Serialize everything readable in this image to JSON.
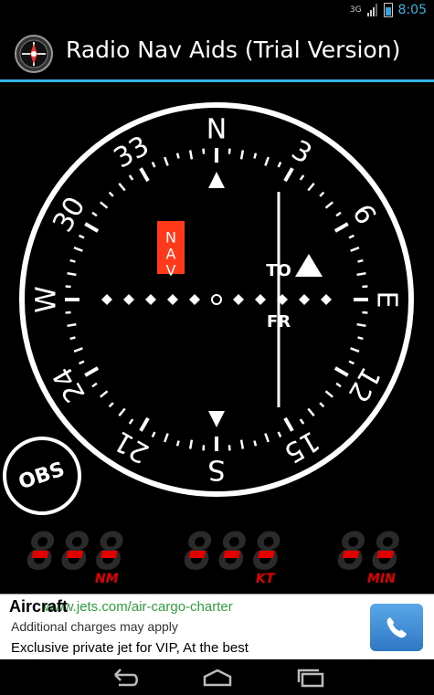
{
  "status_bar": {
    "network": "3G",
    "time": "8:05"
  },
  "action_bar": {
    "app_icon": "compass-instrument-icon",
    "title": "Radio Nav Aids (Trial Version)"
  },
  "instrument": {
    "cardinals": {
      "north": "N",
      "east": "E",
      "south": "S",
      "west": "W"
    },
    "bearing_labels": [
      "3",
      "6",
      "12",
      "15",
      "21",
      "24",
      "30",
      "33"
    ],
    "nav_flag": "NAV",
    "to_label": "TO",
    "from_label": "FR",
    "obs_button": "OBS"
  },
  "readouts": [
    {
      "value": "---",
      "unit": "NM"
    },
    {
      "value": "---",
      "unit": "KT"
    },
    {
      "value": "--",
      "unit": "MIN"
    }
  ],
  "ad": {
    "headline": "Aircraft",
    "url": "www.jets.com/air-cargo-charter",
    "note": "Additional charges may apply",
    "description": "Exclusive private jet for VIP, At the best",
    "call_icon": "phone-icon"
  },
  "nav_bar": {
    "back_icon": "back-icon",
    "home_icon": "home-icon",
    "recents_icon": "recents-icon"
  },
  "colors": {
    "accent": "#33b5e5",
    "flag": "#ff3a1a",
    "readout": "#e00000",
    "ad_url": "#2e9e3e"
  }
}
